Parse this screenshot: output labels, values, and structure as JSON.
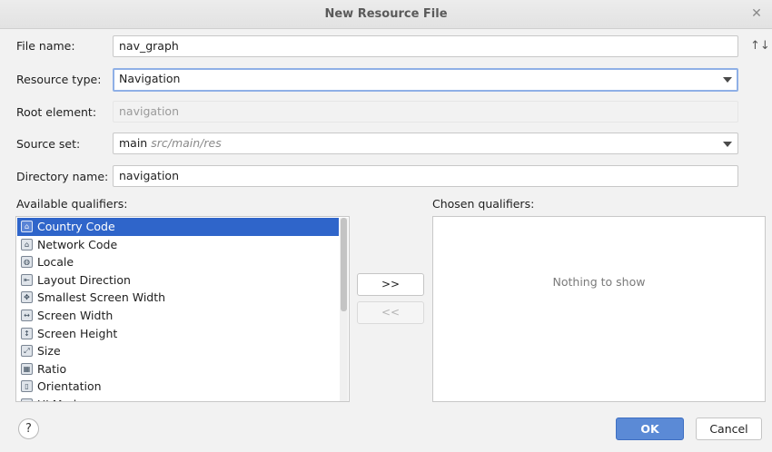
{
  "window": {
    "title": "New Resource File",
    "close_icon": "close-icon"
  },
  "form": {
    "file_name": {
      "label": "File name:",
      "value": "nav_graph"
    },
    "resource_type": {
      "label": "Resource type:",
      "value": "Navigation"
    },
    "root_element": {
      "label": "Root element:",
      "value": "navigation"
    },
    "source_set": {
      "label": "Source set:",
      "value": "main",
      "hint": "src/main/res"
    },
    "directory_name": {
      "label": "Directory name:",
      "value": "navigation"
    }
  },
  "qualifiers": {
    "available_label": "Available qualifiers:",
    "chosen_label": "Chosen qualifiers:",
    "empty_text": "Nothing to show",
    "items": [
      {
        "label": "Country Code",
        "icon": "country-code-icon",
        "glyph": "⌂",
        "selected": true
      },
      {
        "label": "Network Code",
        "icon": "network-code-icon",
        "glyph": "⌂",
        "selected": false
      },
      {
        "label": "Locale",
        "icon": "globe-icon",
        "glyph": "◍",
        "selected": false
      },
      {
        "label": "Layout Direction",
        "icon": "layout-direction-icon",
        "glyph": "⇤",
        "selected": false
      },
      {
        "label": "Smallest Screen Width",
        "icon": "smallest-width-icon",
        "glyph": "✥",
        "selected": false
      },
      {
        "label": "Screen Width",
        "icon": "screen-width-icon",
        "glyph": "↔",
        "selected": false
      },
      {
        "label": "Screen Height",
        "icon": "screen-height-icon",
        "glyph": "↕",
        "selected": false
      },
      {
        "label": "Size",
        "icon": "size-icon",
        "glyph": "⤢",
        "selected": false
      },
      {
        "label": "Ratio",
        "icon": "ratio-icon",
        "glyph": "▦",
        "selected": false
      },
      {
        "label": "Orientation",
        "icon": "orientation-icon",
        "glyph": "▯",
        "selected": false
      },
      {
        "label": "UI Mode",
        "icon": "ui-mode-icon",
        "glyph": "▭",
        "selected": false
      }
    ],
    "add_button": ">>",
    "remove_button": "<<"
  },
  "footer": {
    "help": "?",
    "ok": "OK",
    "cancel": "Cancel"
  },
  "colors": {
    "selection": "#2f65ca",
    "primary_button": "#5b8ad6",
    "focus_border": "#8fb0e6"
  }
}
